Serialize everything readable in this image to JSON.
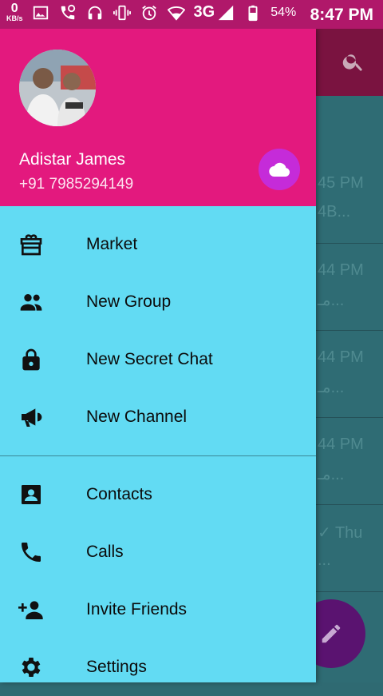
{
  "status_bar": {
    "speed_value": "0",
    "speed_unit": "KB/s",
    "network": "3G",
    "battery_percent": "54%",
    "time": "8:47 PM",
    "icons": [
      "image-icon",
      "call-icon",
      "headphones-icon",
      "vibrate-icon",
      "alarm-icon",
      "wifi-icon",
      "signal-icon",
      "battery-icon"
    ]
  },
  "background": {
    "rows": [
      {
        "time": "45 PM",
        "snippet": "4B..."
      },
      {
        "time": "44 PM",
        "snippet": "مـ..."
      },
      {
        "time": "44 PM",
        "snippet": "مـ..."
      },
      {
        "time": "44 PM",
        "snippet": "مـ..."
      },
      {
        "time": "✓ Thu",
        "snippet": "..."
      }
    ],
    "search_icon": "search-icon",
    "fab_icon": "pencil-icon"
  },
  "drawer": {
    "header_color": "#e3197e",
    "drawer_color": "#62dbf3",
    "user": {
      "name": "Adistar James",
      "phone": "+91 7985294149"
    },
    "cloud_icon": "cloud-icon",
    "menu_primary": [
      {
        "label": "Market",
        "icon": "market-icon"
      },
      {
        "label": "New Group",
        "icon": "group-icon"
      },
      {
        "label": "New Secret Chat",
        "icon": "lock-icon"
      },
      {
        "label": "New Channel",
        "icon": "megaphone-icon"
      }
    ],
    "menu_secondary": [
      {
        "label": "Contacts",
        "icon": "contacts-icon"
      },
      {
        "label": "Calls",
        "icon": "phone-icon"
      },
      {
        "label": "Invite Friends",
        "icon": "add-person-icon"
      },
      {
        "label": "Settings",
        "icon": "gear-icon"
      }
    ]
  }
}
